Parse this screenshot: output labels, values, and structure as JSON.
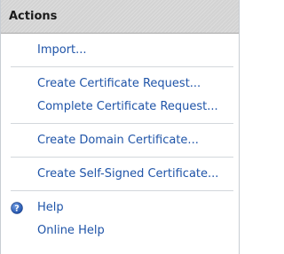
{
  "actions_panel": {
    "title": "Actions",
    "items": [
      {
        "label": "Import..."
      },
      {
        "label": "Create Certificate Request..."
      },
      {
        "label": "Complete Certificate Request..."
      },
      {
        "label": "Create Domain Certificate..."
      },
      {
        "label": "Create Self-Signed Certificate..."
      },
      {
        "label": "Help",
        "icon": "help-icon"
      },
      {
        "label": "Online Help"
      }
    ]
  },
  "colors": {
    "link": "#1f54a8",
    "header_bg": "#d3d3d3",
    "help_icon": "#2a5fb7"
  }
}
